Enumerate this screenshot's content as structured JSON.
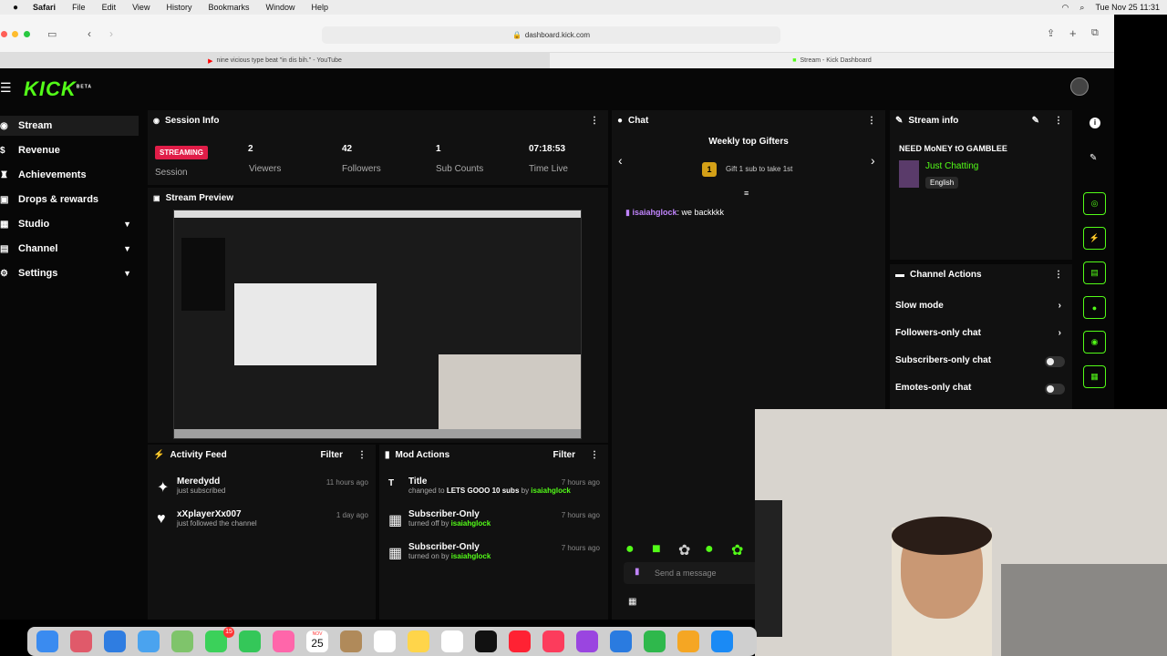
{
  "menubar": {
    "app": "Safari",
    "items": [
      "File",
      "Edit",
      "View",
      "History",
      "Bookmarks",
      "Window",
      "Help"
    ],
    "datetime": "Tue Nov 25  11:31"
  },
  "browser": {
    "url": "dashboard.kick.com",
    "tab1": "nine vicious type beat \"in dis bih.\" - YouTube",
    "tab2": "Stream - Kick Dashboard"
  },
  "logo": {
    "text": "KICK",
    "beta": "BETA"
  },
  "sidebar": [
    "Stream",
    "Revenue",
    "Achievements",
    "Drops & rewards",
    "Studio",
    "Channel",
    "Settings"
  ],
  "session": {
    "title": "Session Info",
    "status": "STREAMING",
    "status_label": "Session",
    "stats": [
      {
        "value": "2",
        "label": "Viewers"
      },
      {
        "value": "42",
        "label": "Followers"
      },
      {
        "value": "1",
        "label": "Sub Counts"
      },
      {
        "value": "07:18:53",
        "label": "Time Live"
      }
    ]
  },
  "preview": {
    "title": "Stream Preview"
  },
  "activity": {
    "title": "Activity Feed",
    "filter": "Filter",
    "items": [
      {
        "name": "Meredydd",
        "sub": "just subscribed",
        "time": "11 hours ago"
      },
      {
        "name": "xXplayerXx007",
        "sub": "just followed the channel",
        "time": "1 day ago"
      }
    ]
  },
  "mod": {
    "title": "Mod Actions",
    "filter": "Filter",
    "items": [
      {
        "name": "Title",
        "pre": "changed to ",
        "bold": "LETS GOOO 10 subs",
        "by": " by ",
        "user": "isaiahglock",
        "time": "7 hours ago"
      },
      {
        "name": "Subscriber-Only",
        "pre": "turned off by ",
        "bold": "",
        "by": "",
        "user": "isaiahglock",
        "time": "7 hours ago"
      },
      {
        "name": "Subscriber-Only",
        "pre": "turned on by ",
        "bold": "",
        "by": "",
        "user": "isaiahglock",
        "time": "7 hours ago"
      }
    ]
  },
  "chat": {
    "title": "Chat",
    "gifters_title": "Weekly top Gifters",
    "gifter_rank": "1",
    "gifter_text": "Gift 1 sub to take 1st",
    "msg_user": "isaiahglock",
    "msg_text": ": we backkkk",
    "placeholder": "Send a message"
  },
  "streaminfo": {
    "title": "Stream info",
    "stream_title": "NEED MoNEY tO GAMBLEE",
    "category": "Just Chatting",
    "language": "English"
  },
  "actions": {
    "title": "Channel Actions",
    "items": [
      "Slow mode",
      "Followers-only chat",
      "Subscribers-only chat",
      "Emotes-only chat"
    ]
  },
  "colors": {
    "accent": "#53fc18",
    "streaming": "#e11d48",
    "username": "#c084fc"
  },
  "dock": {
    "calendar_day": "25",
    "calendar_month": "NOV",
    "badge": "15"
  }
}
